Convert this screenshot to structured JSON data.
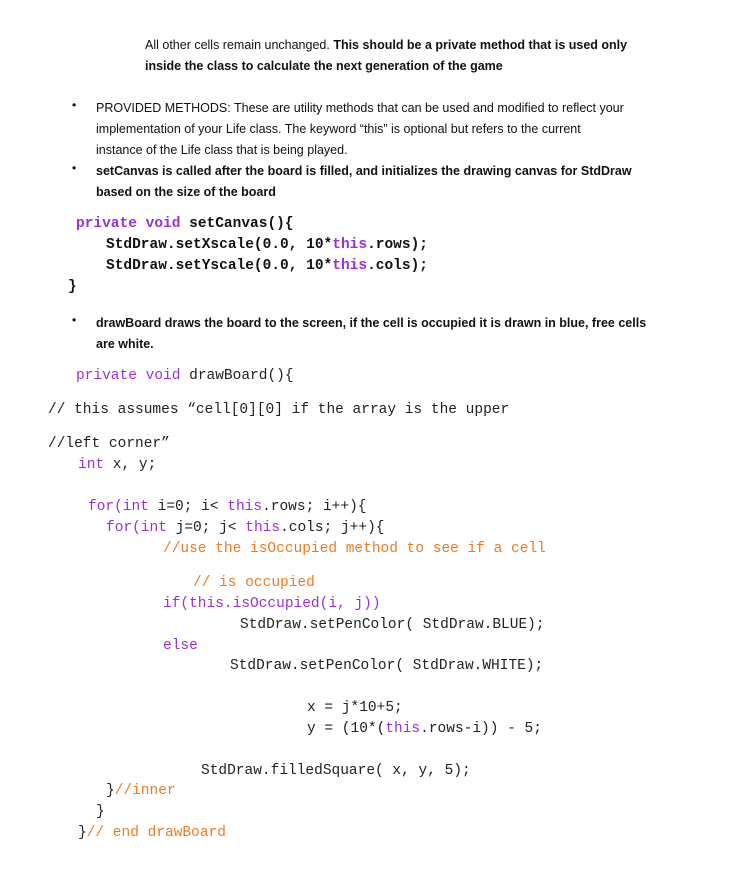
{
  "intro": {
    "line1_plain": "All other cells remain unchanged.  ",
    "line1_bold": "This should be a private method that is used only",
    "line2_bold": "inside the class to calculate the next generation of the game"
  },
  "bullets": [
    {
      "lines": [
        "PROVIDED METHODS:  These are utility methods that can be used and modified to reflect your",
        "implementation of your Life class.  The keyword “this” is optional but refers to the current",
        "instance of the Life class that is being played."
      ],
      "bold": false
    },
    {
      "lines": [
        "setCanvas is called after the board is filled, and initializes the drawing canvas for StdDraw",
        "based on the size of the board"
      ],
      "bold": true
    },
    {
      "lines": [
        "drawBoard draws the board to the screen, if the cell is occupied it is drawn in blue, free cells",
        "are white."
      ],
      "bold": true
    }
  ],
  "bullet_glyph": "•",
  "colors": {
    "keyword": "#9b30d9",
    "comment": "#f07a1f",
    "text": "#222222"
  },
  "setCanvas_code": {
    "l1_kw": "private void ",
    "l1_rest": "setCanvas(){",
    "l2_a": "StdDraw.setXscale(0.0, 10*",
    "l2_kw": "this",
    "l2_b": ".rows);",
    "l3_a": "StdDraw.setYscale(0.0, 10*",
    "l3_kw": "this",
    "l3_b": ".cols);",
    "l4": "}"
  },
  "drawBoard_code": {
    "sig_kw": "private void ",
    "sig_rest": "drawBoard(){",
    "c1": "// this assumes “cell[0][0] if the array is the upper",
    "c2": "//left corner”",
    "decl_kw": "int",
    "decl_rest": " x, y;",
    "for1_kw": "for(int",
    "for1_a": " i=0; i< ",
    "for1_this": "this",
    "for1_b": ".rows; i++){",
    "for2_kw": "for(int",
    "for2_a": " j=0; j< ",
    "for2_this": "this",
    "for2_b": ".cols; j++){",
    "cm1": "//use the isOccupied method to see if a cell",
    "cm2": "// is occupied",
    "if_line": "if(this.isOccupied(i, j))",
    "blue_line": "StdDraw.setPenColor( StdDraw.BLUE);",
    "else_kw": "else",
    "white_line": "StdDraw.setPenColor( StdDraw.WHITE);",
    "x_line": "x = j*10+5;",
    "y_a": "y = (10*(",
    "y_this": "this",
    "y_b": ".rows-i)) - 5;",
    "fill_line": "StdDraw.filledSquare( x, y, 5);",
    "inner_brace": "}",
    "inner_cm": "//inner",
    "outer_brace": "}",
    "end_brace": "}",
    "end_cm": "// end drawBoard"
  }
}
